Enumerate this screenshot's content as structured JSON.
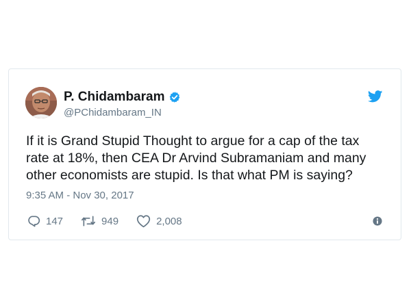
{
  "tweet": {
    "author_name": "P. Chidambaram",
    "handle": "@PChidambaram_IN",
    "text": "If it is Grand Stupid Thought to argue for a cap of the tax\nrate at 18%, then CEA Dr Arvind Subramaniam and many\nother economists are stupid. Is that what PM is saying?",
    "timestamp": "9:35 AM - Nov 30, 2017",
    "replies": "147",
    "retweets": "949",
    "likes": "2,008",
    "verified": true
  },
  "icons": {
    "verified": "verified-badge-icon",
    "brand": "twitter-bird-icon",
    "reply": "reply-icon",
    "retweet": "retweet-icon",
    "like": "heart-icon",
    "info": "info-icon"
  },
  "colors": {
    "brand": "#1da1f2",
    "text": "#14171a",
    "secondary": "#657786",
    "border": "#e1e8ed"
  }
}
